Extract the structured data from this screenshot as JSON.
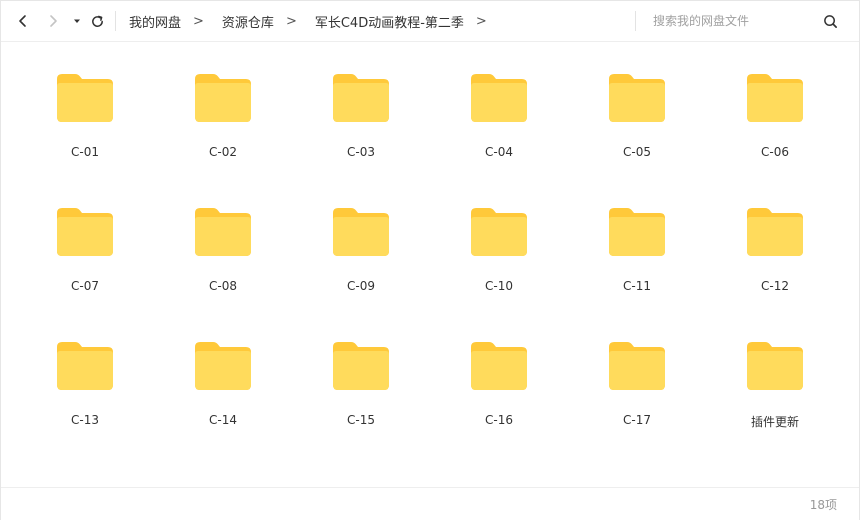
{
  "toolbar": {
    "back_icon": "chevron-left-icon",
    "forward_icon": "chevron-right-icon",
    "dropdown_icon": "caret-down-icon",
    "refresh_icon": "refresh-icon"
  },
  "breadcrumb": {
    "items": [
      "我的网盘",
      "资源仓库",
      "军长C4D动画教程-第二季"
    ],
    "separator": ">"
  },
  "search": {
    "placeholder": "搜索我的网盘文件",
    "icon": "search-icon"
  },
  "folders": [
    {
      "name": "C-01"
    },
    {
      "name": "C-02"
    },
    {
      "name": "C-03"
    },
    {
      "name": "C-04"
    },
    {
      "name": "C-05"
    },
    {
      "name": "C-06"
    },
    {
      "name": "C-07"
    },
    {
      "name": "C-08"
    },
    {
      "name": "C-09"
    },
    {
      "name": "C-10"
    },
    {
      "name": "C-11"
    },
    {
      "name": "C-12"
    },
    {
      "name": "C-13"
    },
    {
      "name": "C-14"
    },
    {
      "name": "C-15"
    },
    {
      "name": "C-16"
    },
    {
      "name": "C-17"
    },
    {
      "name": "插件更新"
    }
  ],
  "status": {
    "count_text": "18项"
  },
  "colors": {
    "folder_back": "#FFC93A",
    "folder_front": "#FFDB5C",
    "text": "#333333",
    "muted": "#999999"
  }
}
